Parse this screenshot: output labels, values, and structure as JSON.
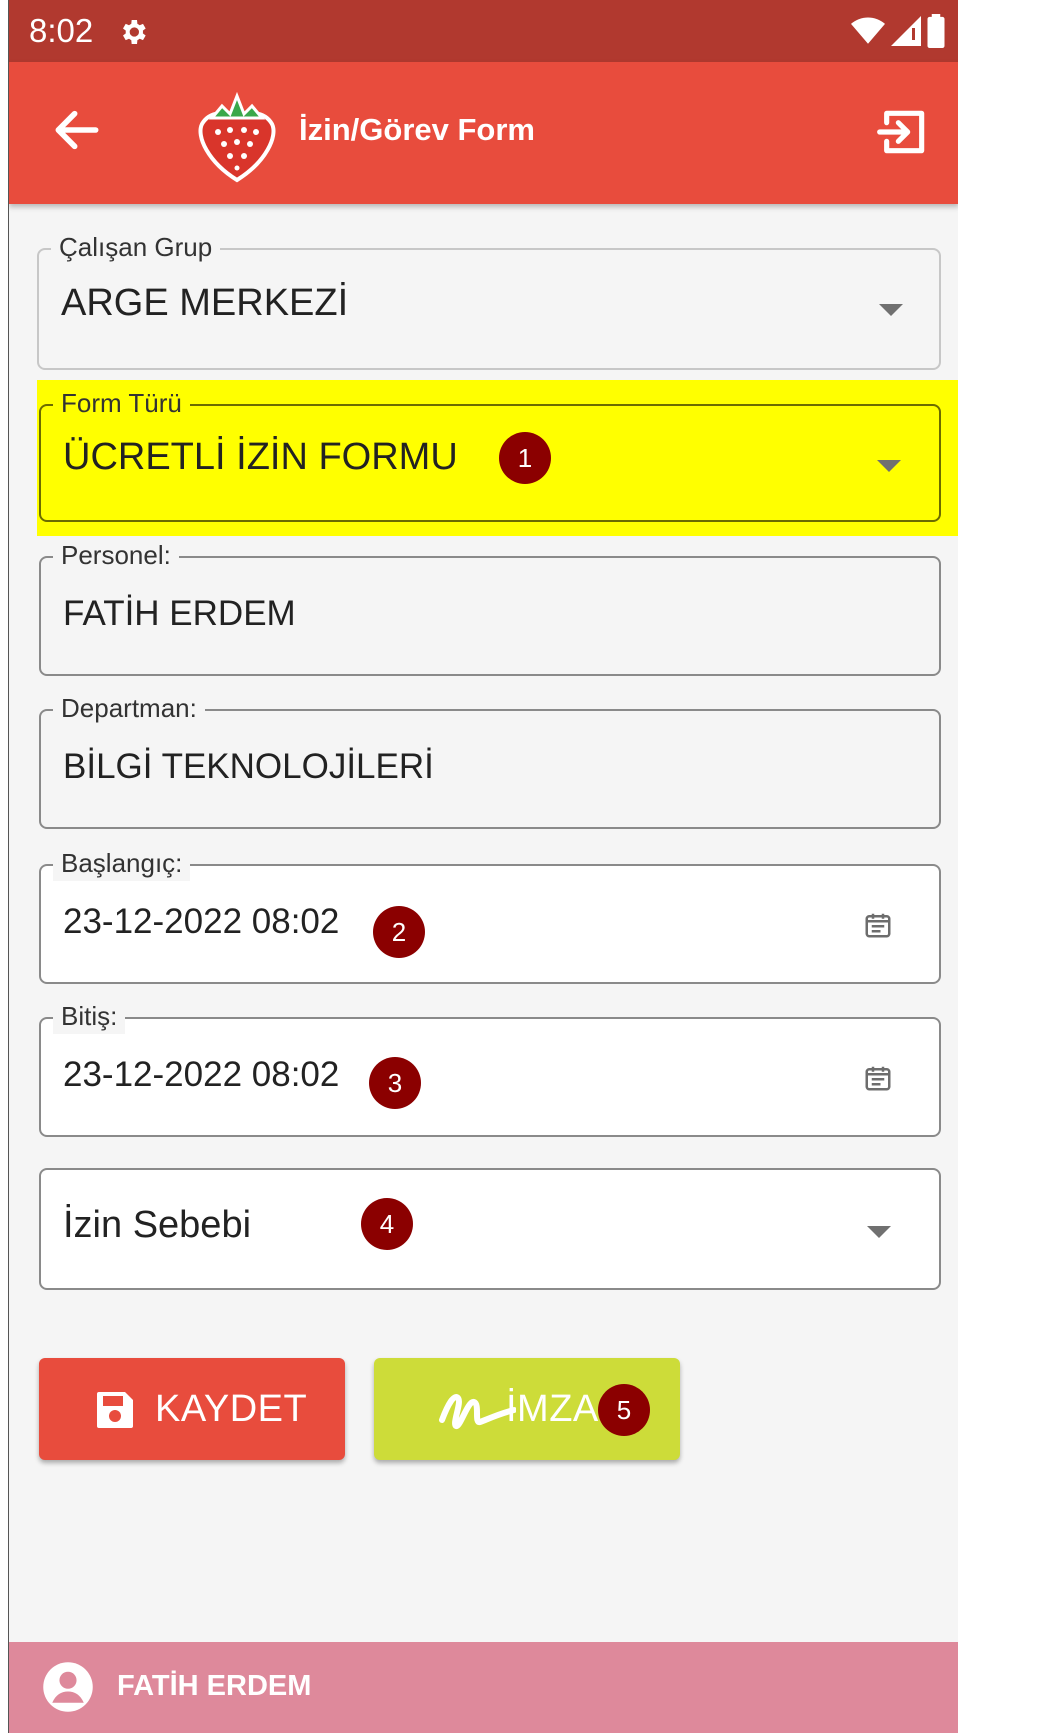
{
  "status": {
    "time": "8:02"
  },
  "app_bar": {
    "title": "İzin/Görev Form"
  },
  "fields": {
    "employee_group": {
      "label": "Çalışan Grup",
      "value": "ARGE MERKEZİ"
    },
    "form_type": {
      "label": "Form Türü",
      "value": "ÜCRETLİ İZİN FORMU",
      "highlight_color": "#ffff00"
    },
    "staff": {
      "label": "Personel:",
      "value": "FATİH ERDEM"
    },
    "department": {
      "label": "Departman:",
      "value": "BİLGİ TEKNOLOJİLERİ"
    },
    "start": {
      "label": "Başlangıç:",
      "value": "23-12-2022 08:02"
    },
    "end": {
      "label": "Bitiş:",
      "value": "23-12-2022 08:02"
    },
    "leave_reason": {
      "placeholder": "İzin Sebebi"
    }
  },
  "badges": [
    "1",
    "2",
    "3",
    "4",
    "5"
  ],
  "buttons": {
    "save": "KAYDET",
    "sign": "İMZA"
  },
  "user_bar": {
    "name": "FATİH ERDEM"
  },
  "colors": {
    "status_bar": "#b1392f",
    "app_bar": "#e84c3d",
    "save_button": "#e84c3d",
    "sign_button": "#cddc39",
    "user_bar": "#de899b",
    "badge": "#8b0000"
  }
}
